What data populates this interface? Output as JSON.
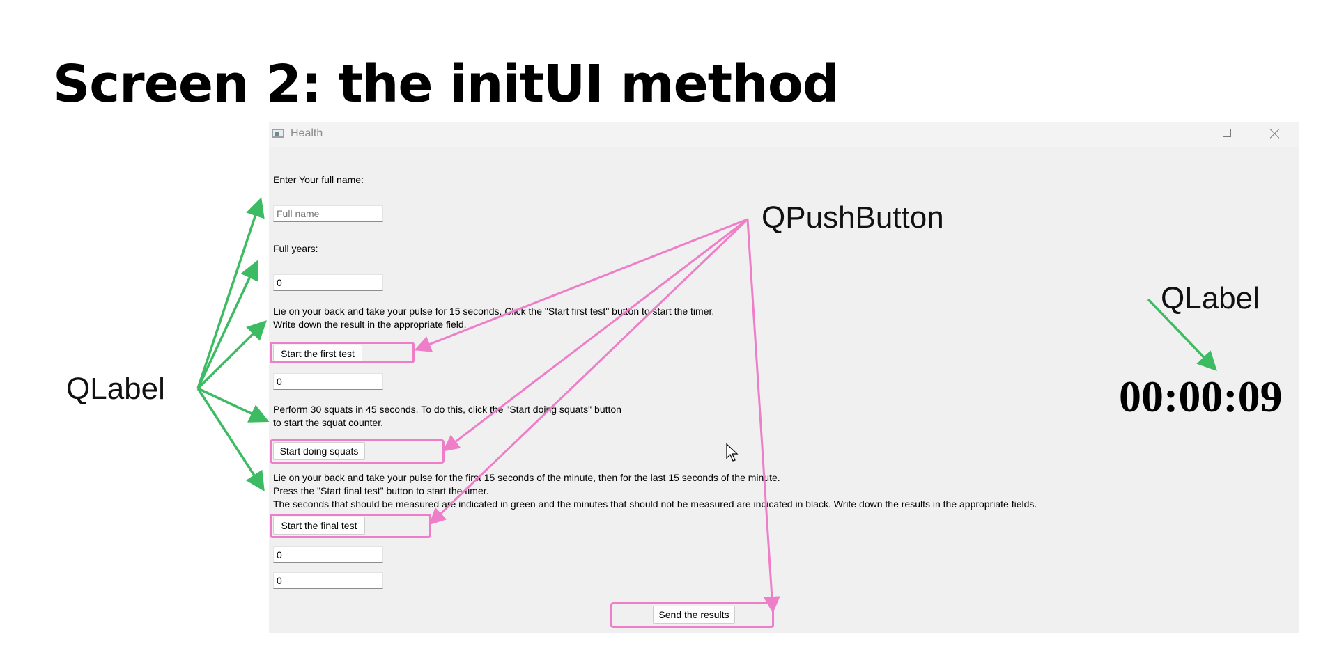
{
  "slide": {
    "title": "Screen 2: the initUI method",
    "annotations": {
      "label_left": "QLabel",
      "push_button": "QPushButton",
      "label_right": "QLabel"
    },
    "colors": {
      "label_arrows": "#3dbb62",
      "button_arrows": "#ef7ec9"
    }
  },
  "window": {
    "title": "Health",
    "controls": [
      "minimize-icon",
      "maximize-icon",
      "close-icon"
    ]
  },
  "form": {
    "name_label": "Enter Your full name:",
    "name_placeholder": "Full name",
    "years_label": "Full years:",
    "years_value": "0",
    "test1_instruction_line1": "Lie on your back and take your pulse for 15 seconds. Click the \"Start first test\" button to start the timer.",
    "test1_instruction_line2": "Write down the result in the appropriate field.",
    "start_first_button": "Start the first test",
    "test1_value": "0",
    "squats_instruction_line1": "Perform 30 squats in 45 seconds. To do this, click the \"Start doing squats\" button",
    "squats_instruction_line2": "to start the squat counter.",
    "start_squats_button": "Start doing squats",
    "final_instruction_line1": "Lie on your back and take your pulse for the first 15 seconds of the minute, then for the last 15 seconds of the minute.",
    "final_instruction_line2": "Press the \"Start final test\" button to start the timer.",
    "final_instruction_line3": "The seconds that should be measured are indicated in green and the minutes that should not be measured are indicated in black. Write down the results in the appropriate fields.",
    "start_final_button": "Start the final test",
    "final_value_1": "0",
    "final_value_2": "0",
    "send_button": "Send the results"
  },
  "timer": {
    "text": "00:00:09"
  }
}
